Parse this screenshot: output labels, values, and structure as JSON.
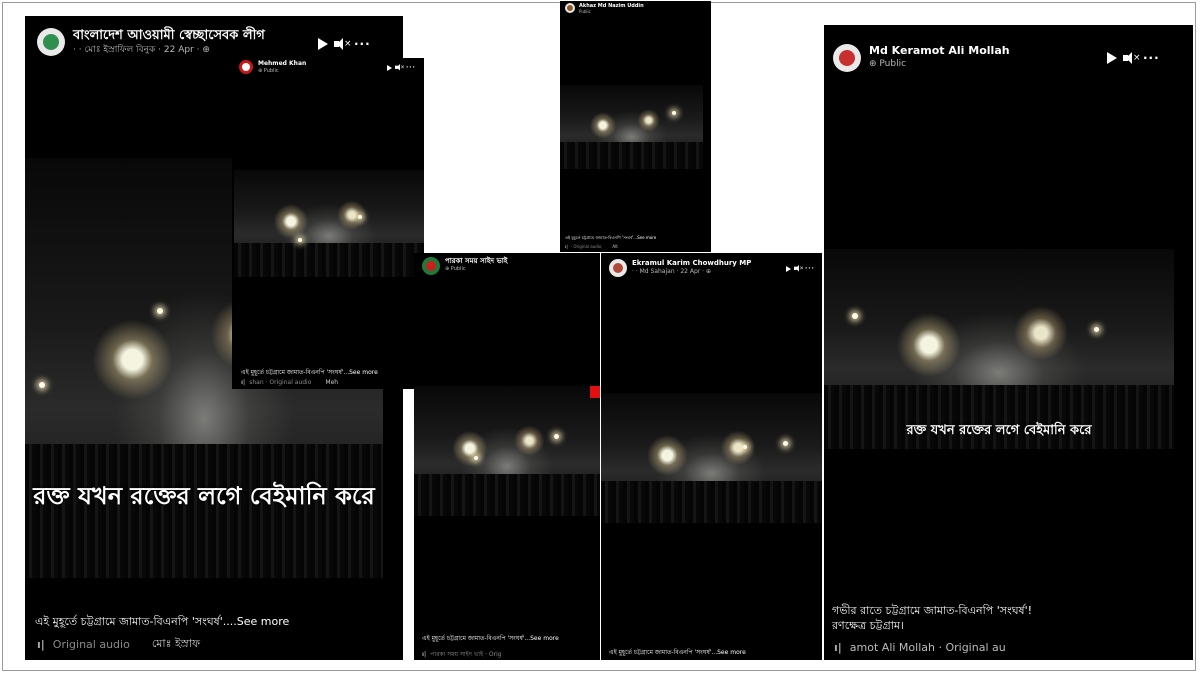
{
  "posts": [
    {
      "author": "বাংলাদেশ আওয়ামী স্বেচ্ছাসেবক লীগ",
      "sub": "· · মোঃ ইস্রাফিল বিনুক · 22 Apr · ⊕",
      "overlay": "রক্ত যখন রক্তের লগে বেইমানি করে",
      "caption": "এই মুহূর্তে চট্টগ্রামে জামাত-বিএনপি 'সংঘর্ষ'....See more",
      "audio": "Original audio",
      "audio_author": "মোঃ ইস্রাফ"
    },
    {
      "author": "Mehmed Khan",
      "sub": "⊕ Public",
      "caption": "এই মুহূর্তে চট্টগ্রামে জামাত-বিএনপি 'সংঘর্ষ'...See more",
      "audio": "shan · Original audio",
      "audio_author": "Meh"
    },
    {
      "author": "Akhaz Md Nazim Uddin",
      "sub": "Public",
      "caption": "এই মুহূর্তে চট্টগ্রামে জামাত-বিএনপি 'সংঘর্ষ'...See more",
      "audio": "· Original audio",
      "audio_author": "Alt"
    },
    {
      "author": "পারকা সময় সাইদ ভাই",
      "sub": "⊕ Public",
      "caption": "এই মুহূর্তে চট্টগ্রামে জামাত-বিএনপি 'সংঘর্ষ'...See more",
      "audio": "পারকা সময় সাইদ ভাই · Orig"
    },
    {
      "author": "Ekramul Karim Chowdhury MP",
      "sub": "· · Md Sahajan · 22 Apr · ⊕",
      "caption": "এই মুহূর্তে চট্টগ্রামে জামাত-বিএনপি 'সংঘর্ষ'...See more"
    },
    {
      "author": "Md Keramot Ali Mollah",
      "sub": "⊕ Public",
      "overlay": "রক্ত যখন রক্তের লগে বেইমানি করে",
      "caption_line1": "গভীর রাতে চট্টগ্রামে জামাত-বিএনপি 'সংঘর্ষ'!",
      "caption_line2": "রণক্ষেত্র চট্টগ্রাম।",
      "audio": "amot Ali Mollah · Original au"
    }
  ],
  "controls": {
    "more": "···",
    "mute_x": "×"
  },
  "colors": {
    "card_bg": "#000000",
    "page_bg": "#ffffff",
    "red_marker": "#e01010"
  }
}
